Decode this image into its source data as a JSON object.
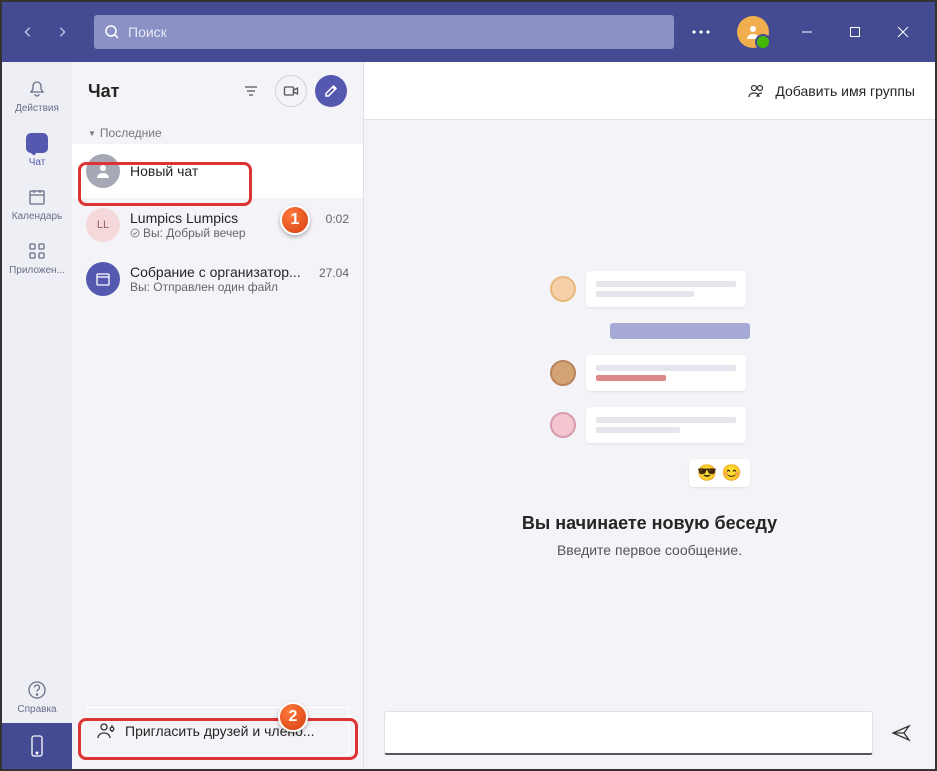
{
  "search": {
    "placeholder": "Поиск"
  },
  "rail": {
    "actions": "Действия",
    "chat": "Чат",
    "calendar": "Календарь",
    "apps": "Приложен...",
    "help": "Справка"
  },
  "chatlist": {
    "title": "Чат",
    "section": "Последние",
    "items": [
      {
        "name": "Новый чат",
        "preview": "",
        "time": ""
      },
      {
        "name": "Lumpics Lumpics",
        "preview": "Вы: Добрый вечер",
        "time": "0:02"
      },
      {
        "name": "Собрание с организатор...",
        "preview": "Вы: Отправлен один файл",
        "time": "27.04"
      }
    ],
    "invite": "Пригласить друзей и члено..."
  },
  "main": {
    "add_group": "Добавить имя группы",
    "heading": "Вы начинаете новую беседу",
    "sub": "Введите первое сообщение."
  },
  "badges": {
    "one": "1",
    "two": "2"
  }
}
